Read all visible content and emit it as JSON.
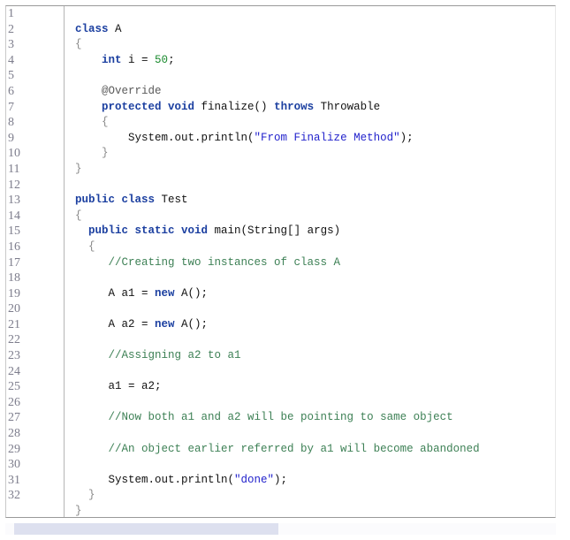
{
  "editor": {
    "language": "java",
    "total_lines": 32,
    "line_numbers": [
      "1",
      "2",
      "3",
      "4",
      "5",
      "6",
      "7",
      "8",
      "9",
      "10",
      "11",
      "12",
      "13",
      "14",
      "15",
      "16",
      "17",
      "18",
      "19",
      "20",
      "21",
      "22",
      "23",
      "24",
      "25",
      "26",
      "27",
      "28",
      "29",
      "30",
      "31",
      "32"
    ],
    "colors": {
      "keyword": "#1b3fa0",
      "string": "#2222cc",
      "number": "#1a8a2e",
      "comment": "#3d8055",
      "annotation": "#5a5a5a",
      "brace": "#8a8a8a",
      "plain": "#111111",
      "line_number": "#7d7d8c",
      "background": "#ffffff",
      "scrollbar_thumb": "#dde0ef",
      "scrollbar_track": "#fbfbfd",
      "frame_border": "#9a9a9a"
    },
    "lines": [
      [],
      [
        {
          "t": "class",
          "c": "kw"
        },
        {
          "t": " A",
          "c": "plain"
        }
      ],
      [
        {
          "t": "{",
          "c": "brace"
        }
      ],
      [
        {
          "t": "    ",
          "c": "plain"
        },
        {
          "t": "int",
          "c": "kw"
        },
        {
          "t": " i = ",
          "c": "plain"
        },
        {
          "t": "50",
          "c": "num"
        },
        {
          "t": ";",
          "c": "plain"
        }
      ],
      [],
      [
        {
          "t": "    ",
          "c": "plain"
        },
        {
          "t": "@Override",
          "c": "ann"
        }
      ],
      [
        {
          "t": "    ",
          "c": "plain"
        },
        {
          "t": "protected void",
          "c": "kw"
        },
        {
          "t": " finalize() ",
          "c": "plain"
        },
        {
          "t": "throws",
          "c": "kw"
        },
        {
          "t": " Throwable",
          "c": "plain"
        }
      ],
      [
        {
          "t": "    ",
          "c": "plain"
        },
        {
          "t": "{",
          "c": "brace"
        }
      ],
      [
        {
          "t": "        System.out.println(",
          "c": "plain"
        },
        {
          "t": "\"From Finalize Method\"",
          "c": "str"
        },
        {
          "t": ");",
          "c": "plain"
        }
      ],
      [
        {
          "t": "    ",
          "c": "plain"
        },
        {
          "t": "}",
          "c": "brace"
        }
      ],
      [
        {
          "t": "}",
          "c": "brace"
        }
      ],
      [],
      [
        {
          "t": "public class",
          "c": "kw"
        },
        {
          "t": " Test",
          "c": "plain"
        }
      ],
      [
        {
          "t": "{",
          "c": "brace"
        }
      ],
      [
        {
          "t": "  ",
          "c": "plain"
        },
        {
          "t": "public static void",
          "c": "kw"
        },
        {
          "t": " main(String[] args)",
          "c": "plain"
        }
      ],
      [
        {
          "t": "  ",
          "c": "plain"
        },
        {
          "t": "{",
          "c": "brace"
        }
      ],
      [
        {
          "t": "     ",
          "c": "plain"
        },
        {
          "t": "//Creating two instances of class A",
          "c": "cmt"
        }
      ],
      [],
      [
        {
          "t": "     A a1 = ",
          "c": "plain"
        },
        {
          "t": "new",
          "c": "kw"
        },
        {
          "t": " A();",
          "c": "plain"
        }
      ],
      [],
      [
        {
          "t": "     A a2 = ",
          "c": "plain"
        },
        {
          "t": "new",
          "c": "kw"
        },
        {
          "t": " A();",
          "c": "plain"
        }
      ],
      [],
      [
        {
          "t": "     ",
          "c": "plain"
        },
        {
          "t": "//Assigning a2 to a1",
          "c": "cmt"
        }
      ],
      [],
      [
        {
          "t": "     a1 = a2;",
          "c": "plain"
        }
      ],
      [],
      [
        {
          "t": "     ",
          "c": "plain"
        },
        {
          "t": "//Now both a1 and a2 will be pointing to same object",
          "c": "cmt"
        }
      ],
      [],
      [
        {
          "t": "     ",
          "c": "plain"
        },
        {
          "t": "//An object earlier referred by a1 will become abandoned",
          "c": "cmt"
        }
      ],
      [],
      [
        {
          "t": "     System.out.println(",
          "c": "plain"
        },
        {
          "t": "\"done\"",
          "c": "str"
        },
        {
          "t": ");",
          "c": "plain"
        }
      ],
      [
        {
          "t": "  ",
          "c": "plain"
        },
        {
          "t": "}",
          "c": "brace"
        }
      ],
      [
        {
          "t": "}",
          "c": "brace"
        }
      ],
      []
    ]
  },
  "scrollbar": {
    "orientation": "horizontal",
    "thumb_position_percent": 0,
    "thumb_width_percent": 48
  }
}
